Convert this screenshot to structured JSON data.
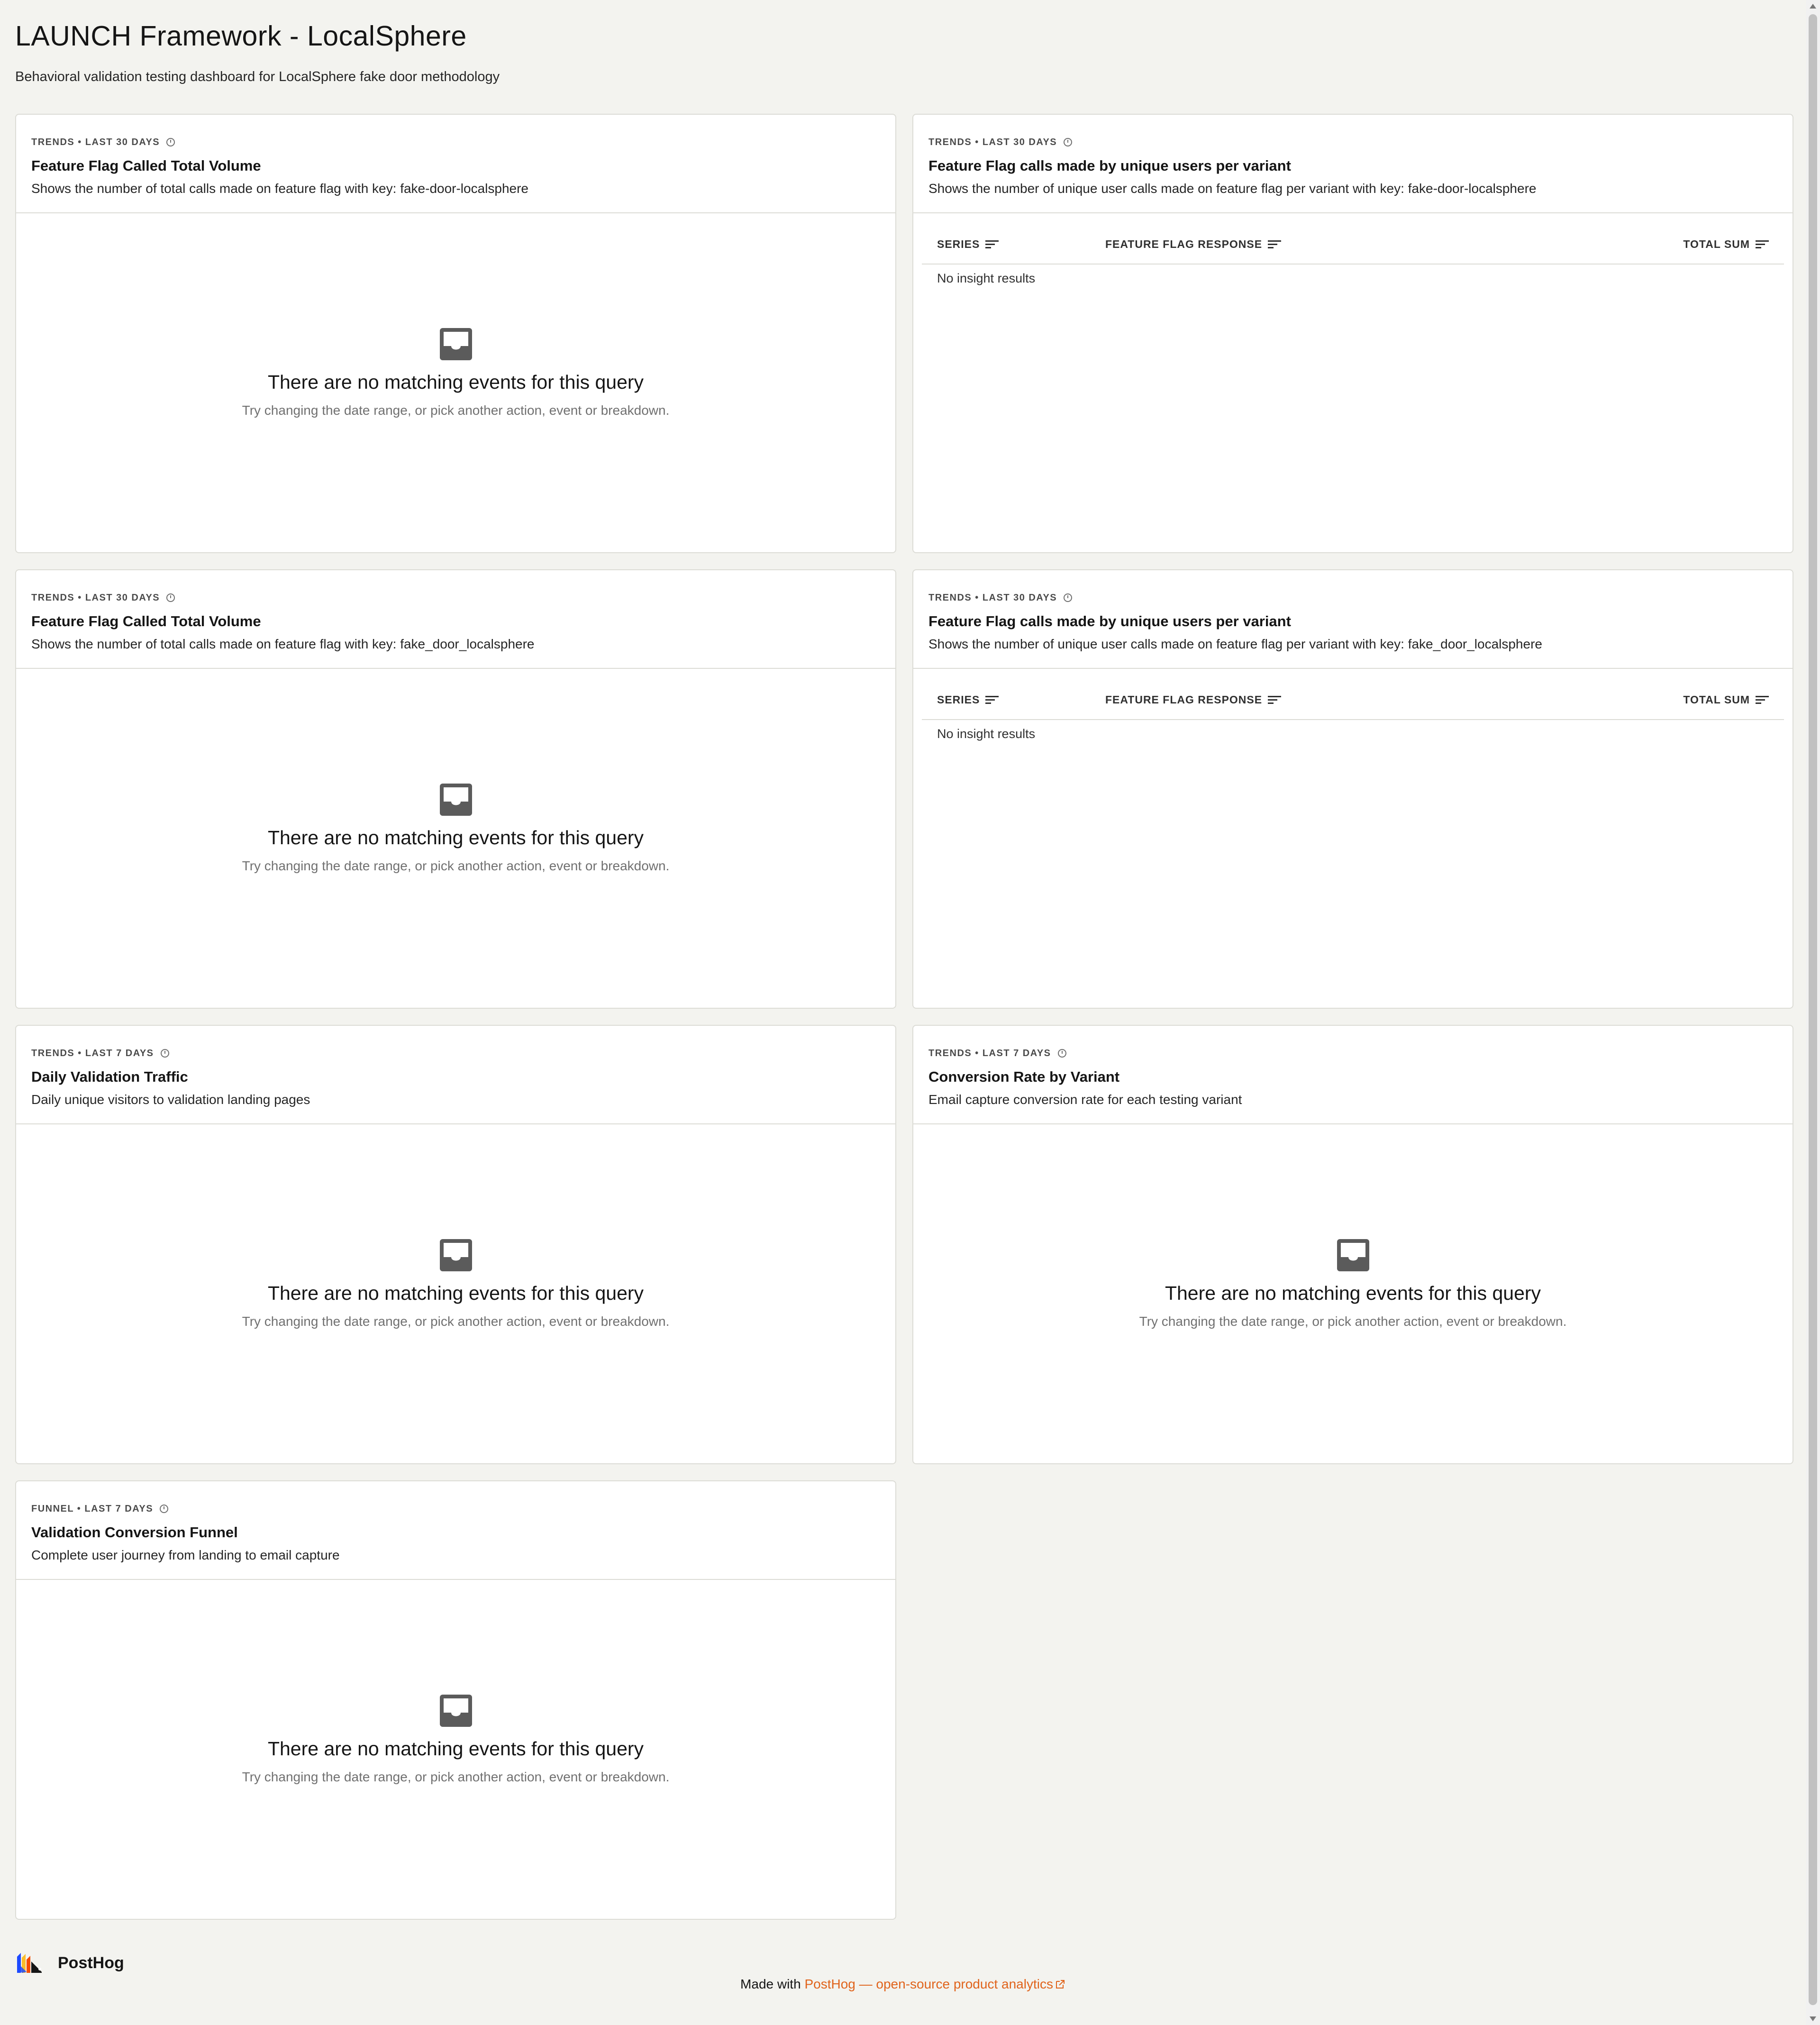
{
  "dashboard": {
    "title": "LAUNCH Framework - LocalSphere",
    "description": "Behavioral validation testing dashboard for LocalSphere fake door methodology"
  },
  "empty_state": {
    "title": "There are no matching events for this query",
    "subtitle": "Try changing the date range, or pick another action, event or breakdown."
  },
  "table": {
    "col_series": "SERIES",
    "col_response": "FEATURE FLAG RESPONSE",
    "col_sum": "TOTAL SUM",
    "no_results": "No insight results"
  },
  "cards": [
    {
      "meta": "TRENDS • LAST 30 DAYS",
      "title": "Feature Flag Called Total Volume",
      "description": "Shows the number of total calls made on feature flag with key: fake-door-localsphere",
      "kind": "empty"
    },
    {
      "meta": "TRENDS • LAST 30 DAYS",
      "title": "Feature Flag calls made by unique users per variant",
      "description": "Shows the number of unique user calls made on feature flag per variant with key: fake-door-localsphere",
      "kind": "table"
    },
    {
      "meta": "TRENDS • LAST 30 DAYS",
      "title": "Feature Flag Called Total Volume",
      "description": "Shows the number of total calls made on feature flag with key: fake_door_localsphere",
      "kind": "empty"
    },
    {
      "meta": "TRENDS • LAST 30 DAYS",
      "title": "Feature Flag calls made by unique users per variant",
      "description": "Shows the number of unique user calls made on feature flag per variant with key: fake_door_localsphere",
      "kind": "table"
    },
    {
      "meta": "TRENDS • LAST 7 DAYS",
      "title": "Daily Validation Traffic",
      "description": "Daily unique visitors to validation landing pages",
      "kind": "empty"
    },
    {
      "meta": "TRENDS • LAST 7 DAYS",
      "title": "Conversion Rate by Variant",
      "description": "Email capture conversion rate for each testing variant",
      "kind": "empty"
    },
    {
      "meta": "FUNNEL • LAST 7 DAYS",
      "title": "Validation Conversion Funnel",
      "description": "Complete user journey from landing to email capture",
      "kind": "empty"
    }
  ],
  "footer": {
    "logo_text": "PostHog",
    "made_with": "Made with ",
    "link_text": "PostHog — open-source product analytics"
  },
  "colors": {
    "background": "#f3f3ef",
    "card": "#ffffff",
    "border": "#dcdcd6",
    "link": "#e0631b",
    "icon": "#5b5b5b"
  }
}
